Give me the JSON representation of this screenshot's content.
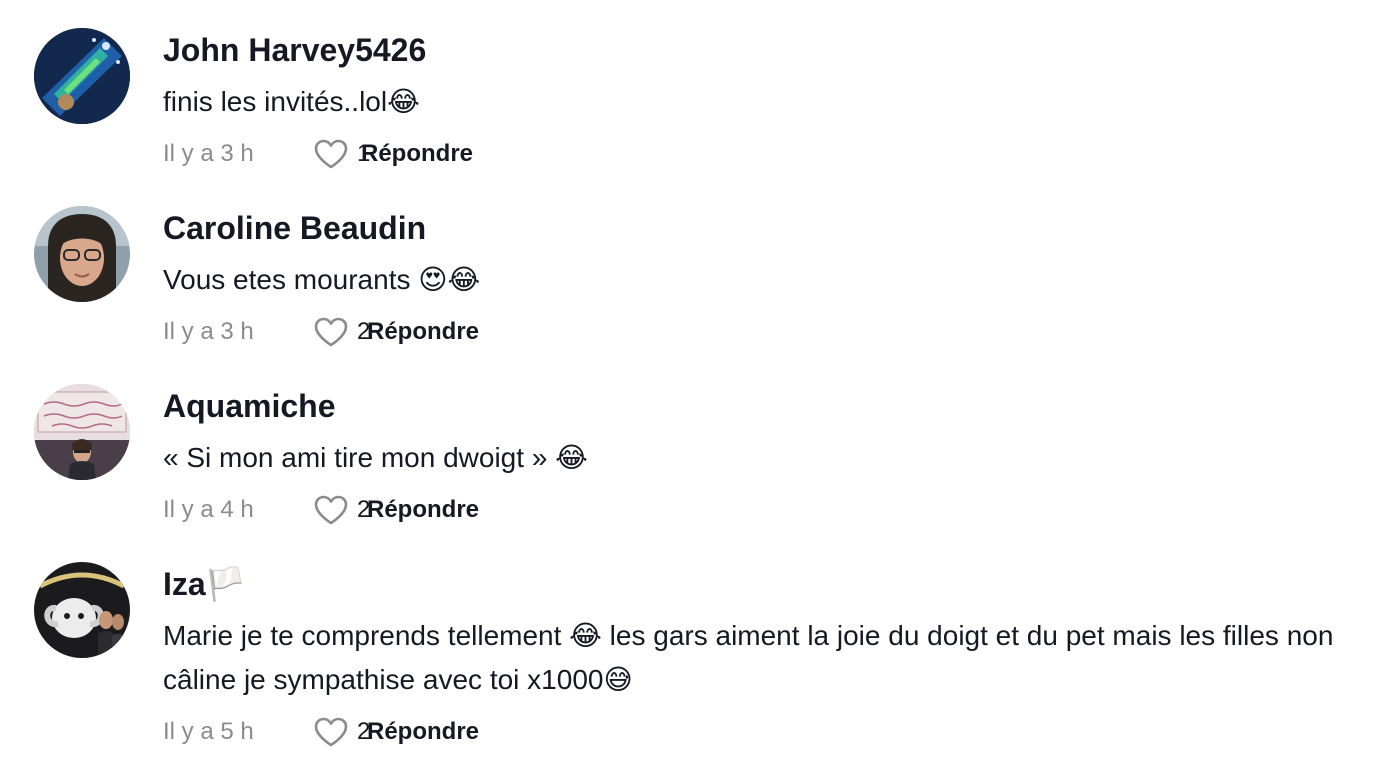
{
  "comments": [
    {
      "username": "John Harvey5426",
      "text": "finis les invités..lol😂",
      "time": "Il y a 3 h",
      "likes": "1",
      "reply_label": "Répondre"
    },
    {
      "username": "Caroline Beaudin",
      "text": "Vous etes mourants 😍😂",
      "time": "Il y a 3 h",
      "likes": "2",
      "reply_label": "Répondre"
    },
    {
      "username": "Aquamiche",
      "text": "« Si mon ami tire mon dwoigt » 😂",
      "time": "Il y a 4 h",
      "likes": "2",
      "reply_label": "Répondre"
    },
    {
      "username": "Iza🏳️",
      "text": "Marie je te comprends tellement 😂 les gars aiment la joie du doigt et du pet mais les filles non câline je sympathise avec toi x1000😅",
      "time": "Il y a 5 h",
      "likes": "2",
      "reply_label": "Répondre"
    }
  ],
  "icons": {
    "like": "heart-outline-icon"
  },
  "colors": {
    "text": "#161823",
    "muted": "#8a8b91",
    "background": "#ffffff"
  }
}
